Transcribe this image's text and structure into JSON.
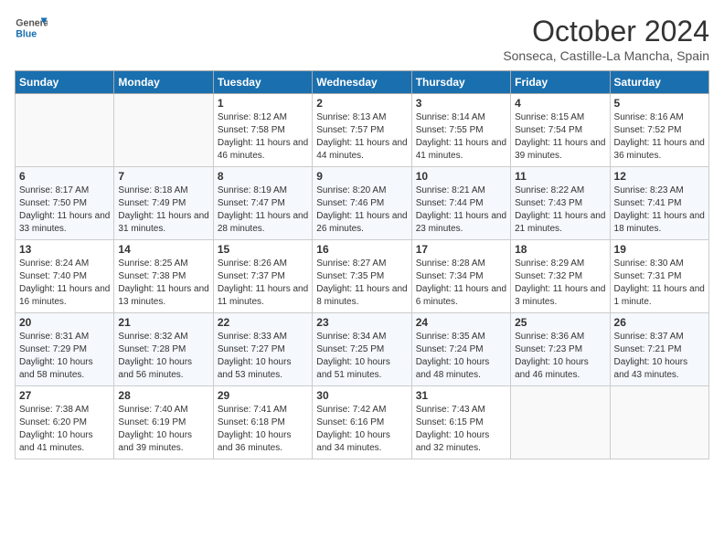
{
  "header": {
    "logo_general": "General",
    "logo_blue": "Blue",
    "month": "October 2024",
    "location": "Sonseca, Castille-La Mancha, Spain"
  },
  "weekdays": [
    "Sunday",
    "Monday",
    "Tuesday",
    "Wednesday",
    "Thursday",
    "Friday",
    "Saturday"
  ],
  "weeks": [
    [
      {
        "day": "",
        "info": ""
      },
      {
        "day": "",
        "info": ""
      },
      {
        "day": "1",
        "info": "Sunrise: 8:12 AM\nSunset: 7:58 PM\nDaylight: 11 hours and 46 minutes."
      },
      {
        "day": "2",
        "info": "Sunrise: 8:13 AM\nSunset: 7:57 PM\nDaylight: 11 hours and 44 minutes."
      },
      {
        "day": "3",
        "info": "Sunrise: 8:14 AM\nSunset: 7:55 PM\nDaylight: 11 hours and 41 minutes."
      },
      {
        "day": "4",
        "info": "Sunrise: 8:15 AM\nSunset: 7:54 PM\nDaylight: 11 hours and 39 minutes."
      },
      {
        "day": "5",
        "info": "Sunrise: 8:16 AM\nSunset: 7:52 PM\nDaylight: 11 hours and 36 minutes."
      }
    ],
    [
      {
        "day": "6",
        "info": "Sunrise: 8:17 AM\nSunset: 7:50 PM\nDaylight: 11 hours and 33 minutes."
      },
      {
        "day": "7",
        "info": "Sunrise: 8:18 AM\nSunset: 7:49 PM\nDaylight: 11 hours and 31 minutes."
      },
      {
        "day": "8",
        "info": "Sunrise: 8:19 AM\nSunset: 7:47 PM\nDaylight: 11 hours and 28 minutes."
      },
      {
        "day": "9",
        "info": "Sunrise: 8:20 AM\nSunset: 7:46 PM\nDaylight: 11 hours and 26 minutes."
      },
      {
        "day": "10",
        "info": "Sunrise: 8:21 AM\nSunset: 7:44 PM\nDaylight: 11 hours and 23 minutes."
      },
      {
        "day": "11",
        "info": "Sunrise: 8:22 AM\nSunset: 7:43 PM\nDaylight: 11 hours and 21 minutes."
      },
      {
        "day": "12",
        "info": "Sunrise: 8:23 AM\nSunset: 7:41 PM\nDaylight: 11 hours and 18 minutes."
      }
    ],
    [
      {
        "day": "13",
        "info": "Sunrise: 8:24 AM\nSunset: 7:40 PM\nDaylight: 11 hours and 16 minutes."
      },
      {
        "day": "14",
        "info": "Sunrise: 8:25 AM\nSunset: 7:38 PM\nDaylight: 11 hours and 13 minutes."
      },
      {
        "day": "15",
        "info": "Sunrise: 8:26 AM\nSunset: 7:37 PM\nDaylight: 11 hours and 11 minutes."
      },
      {
        "day": "16",
        "info": "Sunrise: 8:27 AM\nSunset: 7:35 PM\nDaylight: 11 hours and 8 minutes."
      },
      {
        "day": "17",
        "info": "Sunrise: 8:28 AM\nSunset: 7:34 PM\nDaylight: 11 hours and 6 minutes."
      },
      {
        "day": "18",
        "info": "Sunrise: 8:29 AM\nSunset: 7:32 PM\nDaylight: 11 hours and 3 minutes."
      },
      {
        "day": "19",
        "info": "Sunrise: 8:30 AM\nSunset: 7:31 PM\nDaylight: 11 hours and 1 minute."
      }
    ],
    [
      {
        "day": "20",
        "info": "Sunrise: 8:31 AM\nSunset: 7:29 PM\nDaylight: 10 hours and 58 minutes."
      },
      {
        "day": "21",
        "info": "Sunrise: 8:32 AM\nSunset: 7:28 PM\nDaylight: 10 hours and 56 minutes."
      },
      {
        "day": "22",
        "info": "Sunrise: 8:33 AM\nSunset: 7:27 PM\nDaylight: 10 hours and 53 minutes."
      },
      {
        "day": "23",
        "info": "Sunrise: 8:34 AM\nSunset: 7:25 PM\nDaylight: 10 hours and 51 minutes."
      },
      {
        "day": "24",
        "info": "Sunrise: 8:35 AM\nSunset: 7:24 PM\nDaylight: 10 hours and 48 minutes."
      },
      {
        "day": "25",
        "info": "Sunrise: 8:36 AM\nSunset: 7:23 PM\nDaylight: 10 hours and 46 minutes."
      },
      {
        "day": "26",
        "info": "Sunrise: 8:37 AM\nSunset: 7:21 PM\nDaylight: 10 hours and 43 minutes."
      }
    ],
    [
      {
        "day": "27",
        "info": "Sunrise: 7:38 AM\nSunset: 6:20 PM\nDaylight: 10 hours and 41 minutes."
      },
      {
        "day": "28",
        "info": "Sunrise: 7:40 AM\nSunset: 6:19 PM\nDaylight: 10 hours and 39 minutes."
      },
      {
        "day": "29",
        "info": "Sunrise: 7:41 AM\nSunset: 6:18 PM\nDaylight: 10 hours and 36 minutes."
      },
      {
        "day": "30",
        "info": "Sunrise: 7:42 AM\nSunset: 6:16 PM\nDaylight: 10 hours and 34 minutes."
      },
      {
        "day": "31",
        "info": "Sunrise: 7:43 AM\nSunset: 6:15 PM\nDaylight: 10 hours and 32 minutes."
      },
      {
        "day": "",
        "info": ""
      },
      {
        "day": "",
        "info": ""
      }
    ]
  ]
}
